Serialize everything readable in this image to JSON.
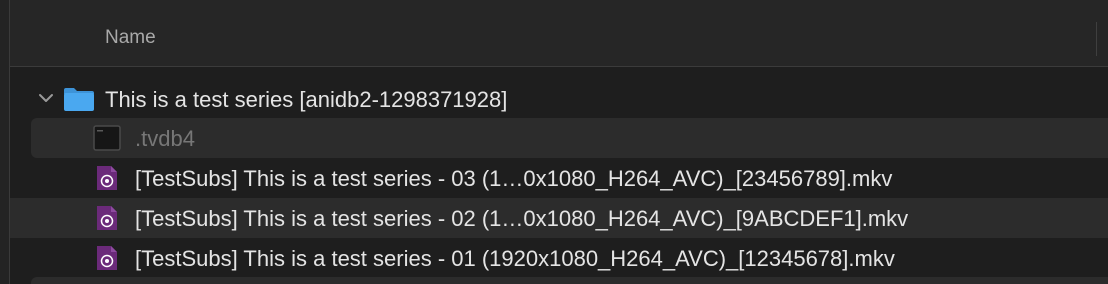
{
  "header": {
    "name_column": "Name"
  },
  "rows": [
    {
      "label": "This is a test series [anidb2-1298371928]",
      "kind": "folder",
      "expanded": true,
      "icon": "folder-icon"
    },
    {
      "label": ".tvdb4",
      "kind": "exec-file",
      "icon": "terminal-file-icon"
    },
    {
      "label": "[TestSubs] This is a test series - 03 (1…0x1080_H264_AVC)_[23456789].mkv",
      "kind": "video",
      "icon": "mkv-video-icon"
    },
    {
      "label": "[TestSubs] This is a test series - 02 (1…0x1080_H264_AVC)_[9ABCDEF1].mkv",
      "kind": "video",
      "icon": "mkv-video-icon"
    },
    {
      "label": "[TestSubs] This is a test series - 01 (1920x1080_H264_AVC)_[12345678].mkv",
      "kind": "video",
      "icon": "mkv-video-icon"
    }
  ],
  "colors": {
    "background": "#1e1e1e",
    "stripe": "#2c2c2c",
    "folder": "#4aa8f0",
    "video_icon": "#6b2a7a",
    "text": "#e4e4e4",
    "dim_text": "#777777"
  }
}
